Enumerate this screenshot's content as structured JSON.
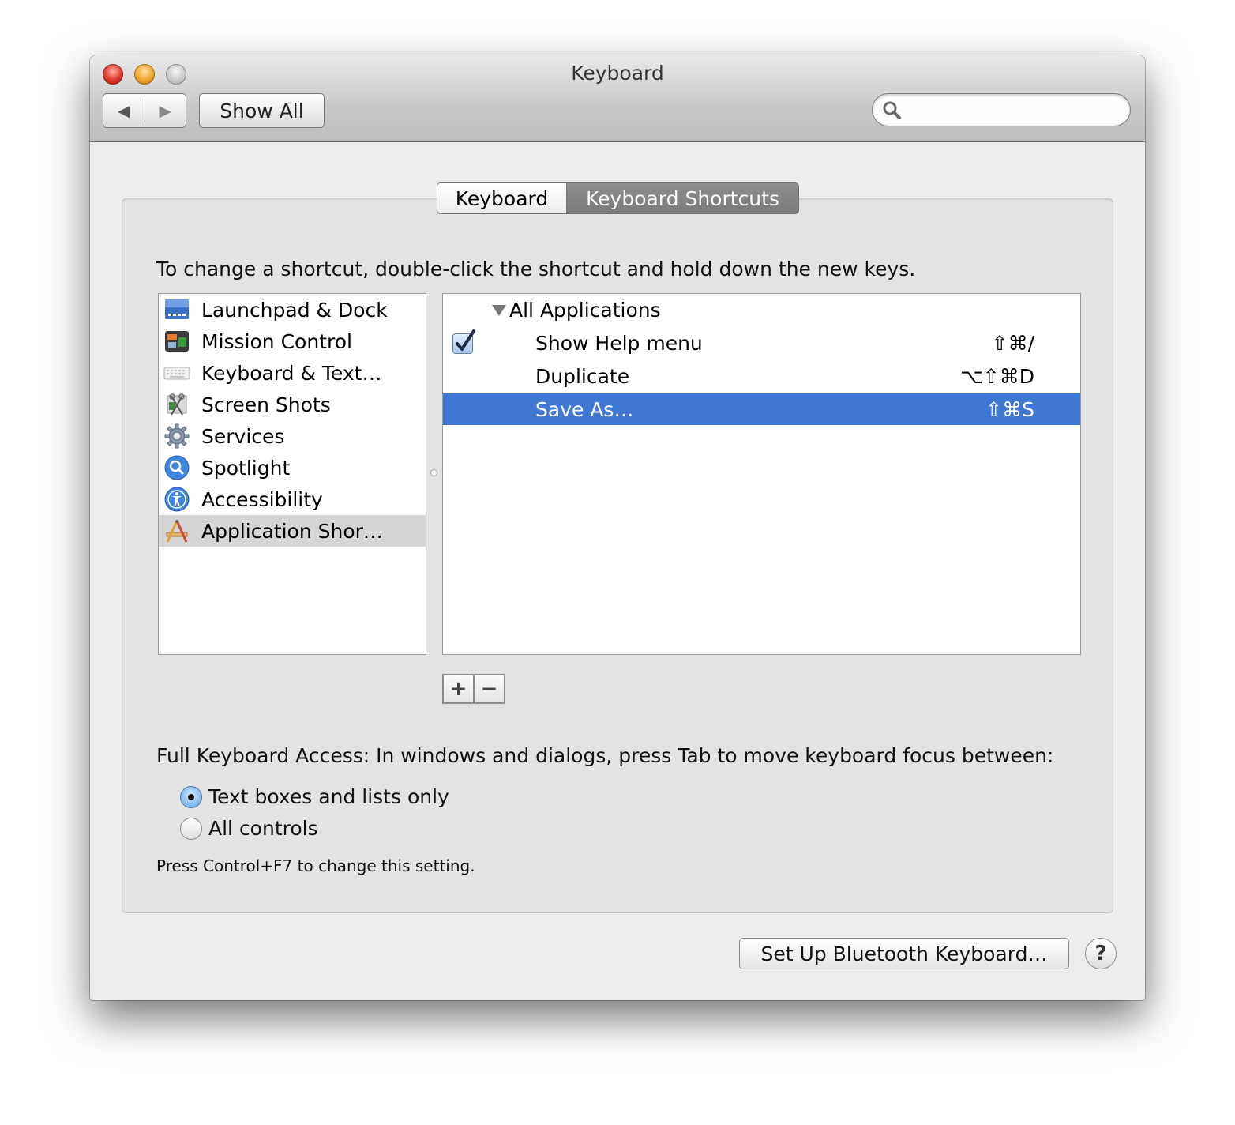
{
  "window": {
    "title": "Keyboard",
    "nav": {
      "back_icon": "◀",
      "forward_icon": "▶"
    },
    "show_all_label": "Show All",
    "search": {
      "value": "",
      "placeholder": ""
    }
  },
  "tabs": [
    {
      "label": "Keyboard",
      "selected": false
    },
    {
      "label": "Keyboard Shortcuts",
      "selected": true
    }
  ],
  "instructions": "To change a shortcut, double-click the shortcut and hold down the new keys.",
  "categories": [
    {
      "label": "Launchpad & Dock",
      "icon": "launchpad-dock-icon"
    },
    {
      "label": "Mission Control",
      "icon": "mission-control-icon"
    },
    {
      "label": "Keyboard & Text…",
      "icon": "keyboard-icon"
    },
    {
      "label": "Screen Shots",
      "icon": "screenshot-icon"
    },
    {
      "label": "Services",
      "icon": "gear-icon"
    },
    {
      "label": "Spotlight",
      "icon": "spotlight-icon"
    },
    {
      "label": "Accessibility",
      "icon": "accessibility-icon"
    },
    {
      "label": "Application Shor…",
      "icon": "app-shortcuts-icon",
      "selected": true
    }
  ],
  "shortcuts": {
    "group": "All Applications",
    "items": [
      {
        "name": "Show Help menu",
        "keys": "⇧⌘/",
        "checked": true
      },
      {
        "name": "Duplicate",
        "keys": "⌥⇧⌘D"
      },
      {
        "name": "Save As…",
        "keys": "⇧⌘S",
        "selected": true
      }
    ]
  },
  "add_label": "+",
  "remove_label": "−",
  "full_keyboard_access": {
    "label": "Full Keyboard Access: In windows and dialogs, press Tab to move keyboard focus between:",
    "options": [
      {
        "label": "Text boxes and lists only",
        "selected": true
      },
      {
        "label": "All controls",
        "selected": false
      }
    ],
    "hint": "Press Control+F7 to change this setting."
  },
  "bluetooth_button": "Set Up Bluetooth Keyboard…",
  "help_label": "?",
  "colors": {
    "selection": "#3e78d3",
    "list_selection": "#d5d5d5"
  }
}
